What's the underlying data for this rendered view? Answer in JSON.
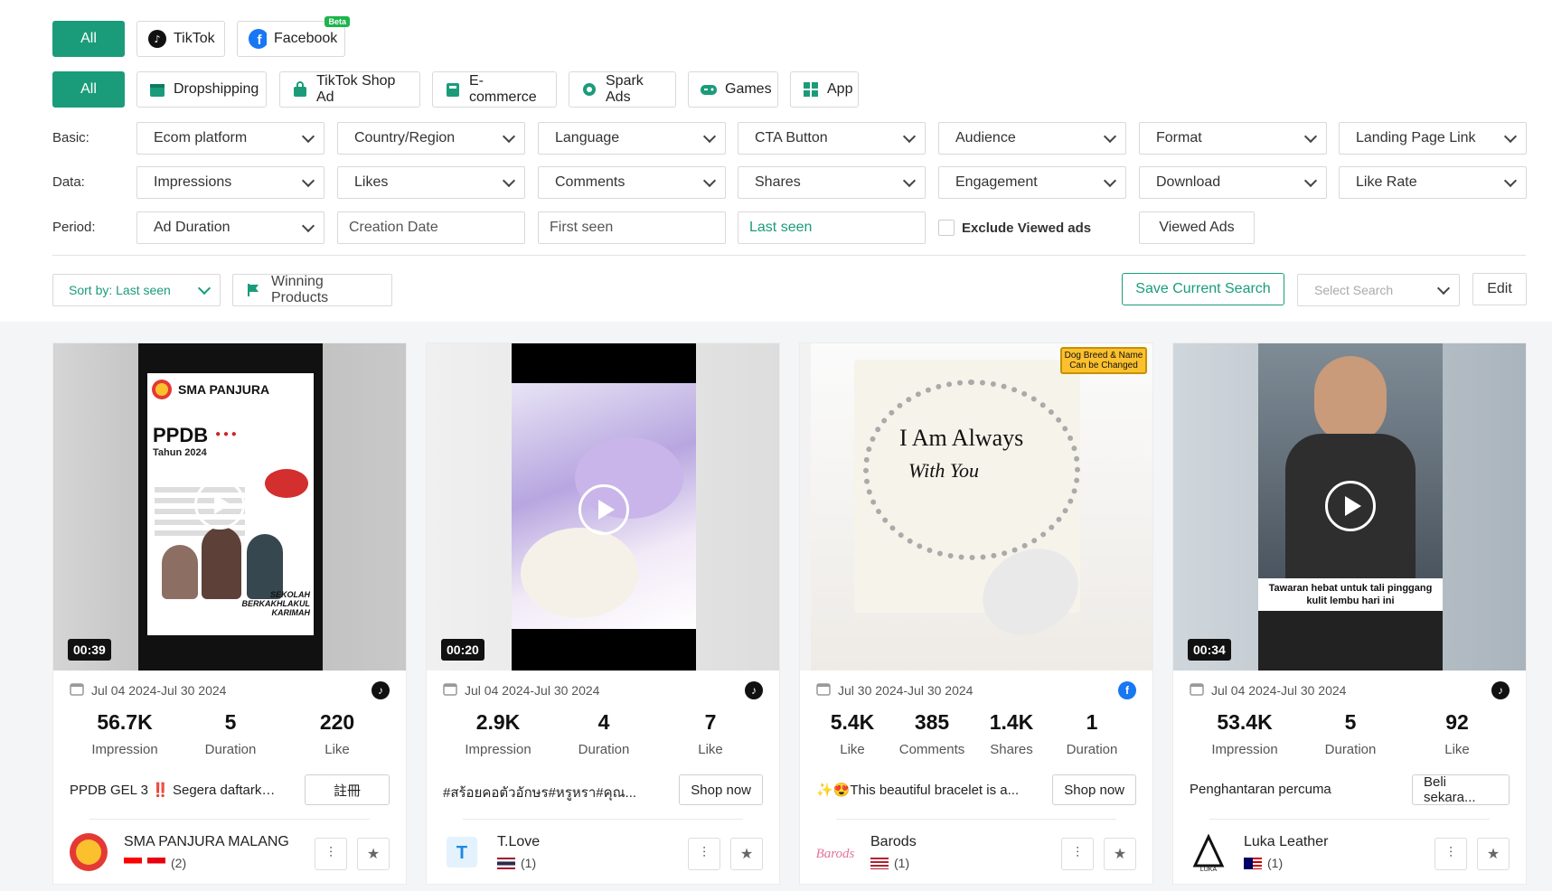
{
  "platforms": [
    "All",
    "TikTok",
    "Facebook"
  ],
  "beta_badge": "Beta",
  "categories": [
    "All",
    "Dropshipping",
    "TikTok Shop Ad",
    "E-commerce",
    "Spark Ads",
    "Games",
    "App"
  ],
  "filters": {
    "basic_label": "Basic:",
    "basic": [
      "Ecom platform",
      "Country/Region",
      "Language",
      "CTA Button",
      "Audience",
      "Format",
      "Landing Page Link"
    ],
    "data_label": "Data:",
    "data": [
      "Impressions",
      "Likes",
      "Comments",
      "Shares",
      "Engagement",
      "Download",
      "Like Rate"
    ],
    "period_label": "Period:",
    "ad_duration": "Ad Duration",
    "creation_date": "Creation Date",
    "first_seen": "First seen",
    "last_seen": "Last seen",
    "exclude_viewed": "Exclude Viewed ads",
    "viewed_ads": "Viewed Ads"
  },
  "toolbar": {
    "sort": "Sort by: Last seen",
    "winning": "Winning Products",
    "save_search": "Save Current Search",
    "select_search": "Select Search",
    "edit": "Edit"
  },
  "colors": {
    "accent": "#1a9c7a",
    "facebook": "#1877f2",
    "tiktok": "#111111"
  },
  "cards": [
    {
      "duration": "00:39",
      "date": "Jul 04 2024-Jul 30 2024",
      "platform_icon": "tiktok-icon",
      "stats": [
        {
          "value": "56.7K",
          "label": "Impression"
        },
        {
          "value": "5",
          "label": "Duration"
        },
        {
          "value": "220",
          "label": "Like"
        }
      ],
      "desc": "PPDB GEL 3 ‼️ Segera daftarkan...",
      "cta": "註冊",
      "advertiser": "SMA PANJURA MALANG",
      "country_count": "(2)",
      "poster": {
        "school": "SMA PANJURA",
        "ppdb": "PPDB",
        "year": "Tahun 2024",
        "tagline": "SEKOLAH BERKAKHLAKUL KARIMAH"
      }
    },
    {
      "duration": "00:20",
      "date": "Jul 04 2024-Jul 30 2024",
      "platform_icon": "tiktok-icon",
      "stats": [
        {
          "value": "2.9K",
          "label": "Impression"
        },
        {
          "value": "4",
          "label": "Duration"
        },
        {
          "value": "7",
          "label": "Like"
        }
      ],
      "desc": "#สร้อยคอตัวอักษร#หรูหรา#คุณ...",
      "cta": "Shop now",
      "advertiser": "T.Love",
      "country_count": "(1)"
    },
    {
      "duration": "",
      "date": "Jul 30 2024-Jul 30 2024",
      "platform_icon": "facebook-icon",
      "stats": [
        {
          "value": "5.4K",
          "label": "Like"
        },
        {
          "value": "385",
          "label": "Comments"
        },
        {
          "value": "1.4K",
          "label": "Shares"
        },
        {
          "value": "1",
          "label": "Duration"
        }
      ],
      "desc": "✨😍This beautiful bracelet is a...",
      "cta": "Shop now",
      "advertiser": "Barods",
      "country_count": "(1)",
      "poster": {
        "badge": "Dog Breed & Name Can be Changed",
        "line1": "I Am Always",
        "line2": "With You"
      }
    },
    {
      "duration": "00:34",
      "date": "Jul 04 2024-Jul 30 2024",
      "platform_icon": "tiktok-icon",
      "stats": [
        {
          "value": "53.4K",
          "label": "Impression"
        },
        {
          "value": "5",
          "label": "Duration"
        },
        {
          "value": "92",
          "label": "Like"
        }
      ],
      "desc": "Penghantaran percuma",
      "cta": "Beli sekara...",
      "advertiser": "Luka Leather",
      "country_count": "(1)",
      "poster": {
        "caption": "Tawaran hebat untuk tali pinggang kulit lembu hari ini"
      }
    }
  ]
}
